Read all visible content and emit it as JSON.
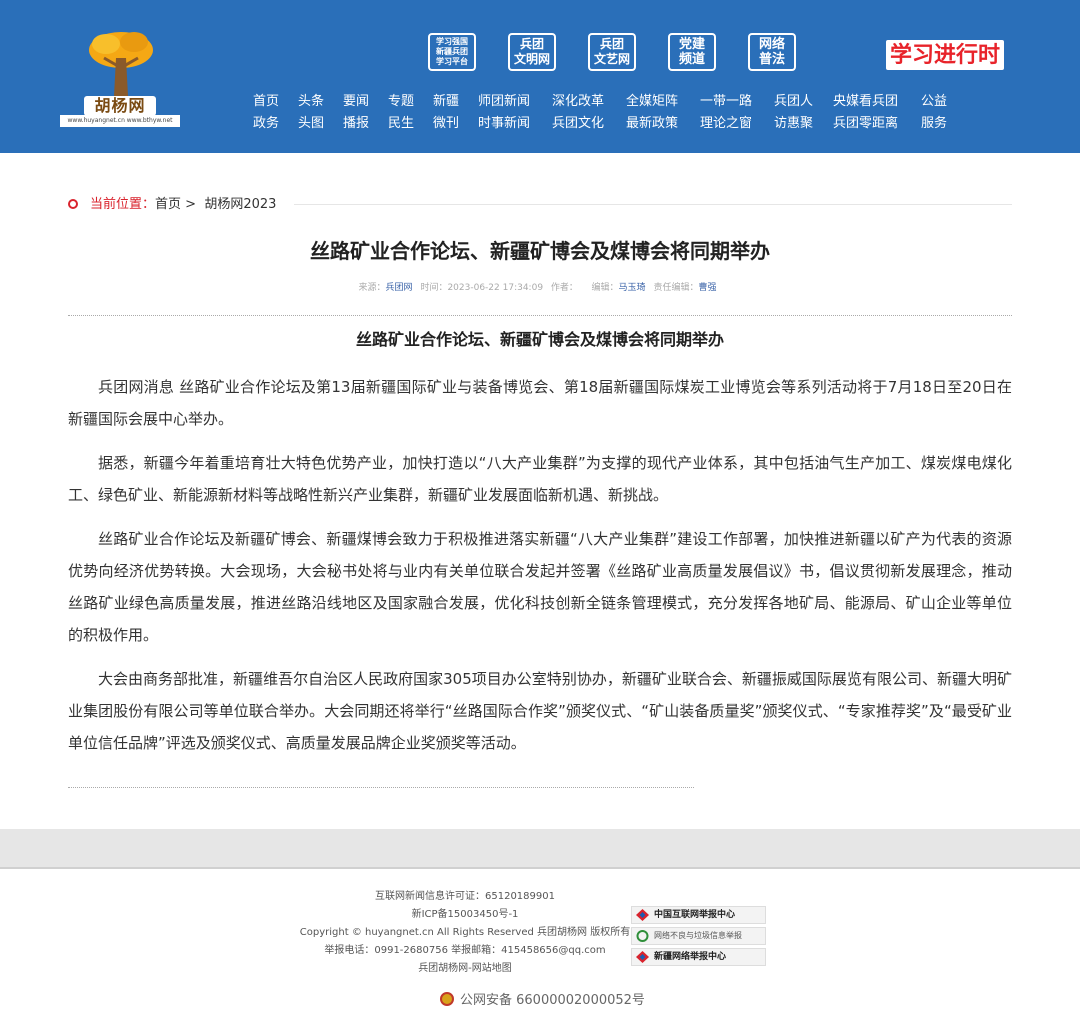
{
  "header": {
    "logo_text": "胡杨网",
    "logo_url": "www.huyangnet.cn  www.bthyw.net",
    "badges": [
      {
        "lines": [
          "学习强国",
          "新疆兵团",
          "学习平台"
        ]
      },
      {
        "lines": [
          "兵团",
          "文明网"
        ]
      },
      {
        "lines": [
          "兵团",
          "文艺网"
        ]
      },
      {
        "lines": [
          "党建",
          "频道"
        ]
      },
      {
        "lines": [
          "网络",
          "普法"
        ]
      }
    ],
    "xuexi": "学习进行时",
    "nav_row1": [
      "首页",
      "头条",
      "要闻",
      "专题",
      "新疆",
      "师团新闻",
      "深化改革",
      "全媒矩阵",
      "一带一路",
      "兵团人",
      "央媒看兵团",
      "公益"
    ],
    "nav_row2": [
      "政务",
      "头图",
      "播报",
      "民生",
      "微刊",
      "时事新闻",
      "兵团文化",
      "最新政策",
      "理论之窗",
      "访惠聚",
      "兵团零距离",
      "服务"
    ]
  },
  "breadcrumb": {
    "label": "当前位置：",
    "home": "首页",
    "sep": ">",
    "section": "胡杨网2023"
  },
  "article": {
    "title": "丝路矿业合作论坛、新疆矿博会及煤博会将同期举办",
    "meta": {
      "source_label": "来源：",
      "source": "兵团网",
      "time_label": "时间：",
      "time": "2023-06-22 17:34:09",
      "author_label": "作者：",
      "author": "",
      "editor_label": "编辑：",
      "editor": "马玉琦",
      "chief_label": "责任编辑：",
      "chief": "曹强"
    },
    "subtitle": "丝路矿业合作论坛、新疆矿博会及煤博会将同期举办",
    "paragraphs": [
      "兵团网消息 丝路矿业合作论坛及第13届新疆国际矿业与装备博览会、第18届新疆国际煤炭工业博览会等系列活动将于7月18日至20日在新疆国际会展中心举办。",
      "据悉，新疆今年着重培育壮大特色优势产业，加快打造以“八大产业集群”为支撑的现代产业体系，其中包括油气生产加工、煤炭煤电煤化工、绿色矿业、新能源新材料等战略性新兴产业集群，新疆矿业发展面临新机遇、新挑战。",
      "丝路矿业合作论坛及新疆矿博会、新疆煤博会致力于积极推进落实新疆“八大产业集群”建设工作部署，加快推进新疆以矿产为代表的资源优势向经济优势转换。大会现场，大会秘书处将与业内有关单位联合发起并签署《丝路矿业高质量发展倡议》书，倡议贯彻新发展理念，推动丝路矿业绿色高质量发展，推进丝路沿线地区及国家融合发展，优化科技创新全链条管理模式，充分发挥各地矿局、能源局、矿山企业等单位的积极作用。",
      "大会由商务部批准，新疆维吾尔自治区人民政府国家305项目办公室特别协办，新疆矿业联合会、新疆振威国际展览有限公司、新疆大明矿业集团股份有限公司等单位联合举办。大会同期还将举行“丝路国际合作奖”颁奖仪式、“矿山装备质量奖”颁奖仪式、“专家推荐奖”及“最受矿业单位信任品牌”评选及颁奖仪式、高质量发展品牌企业奖颁奖等活动。"
    ]
  },
  "footer": {
    "lines": [
      "互联网新闻信息许可证：65120189901",
      "新ICP备15003450号-1",
      "Copyright © huyangnet.cn All Rights Reserved 兵团胡杨网 版权所有",
      "举报电话：0991-2680756 举报邮箱：415458656@qq.com",
      "兵团胡杨网-网站地图"
    ],
    "report_badges": [
      "中国互联网举报中心",
      "网络不良与垃圾信息举报",
      "新疆网络举报中心"
    ],
    "police": "公网安备 66000002000052号"
  },
  "colors": {
    "header_bg": "#2a6fb9",
    "accent_red": "#d9232d",
    "link_blue": "#3a63a8"
  }
}
